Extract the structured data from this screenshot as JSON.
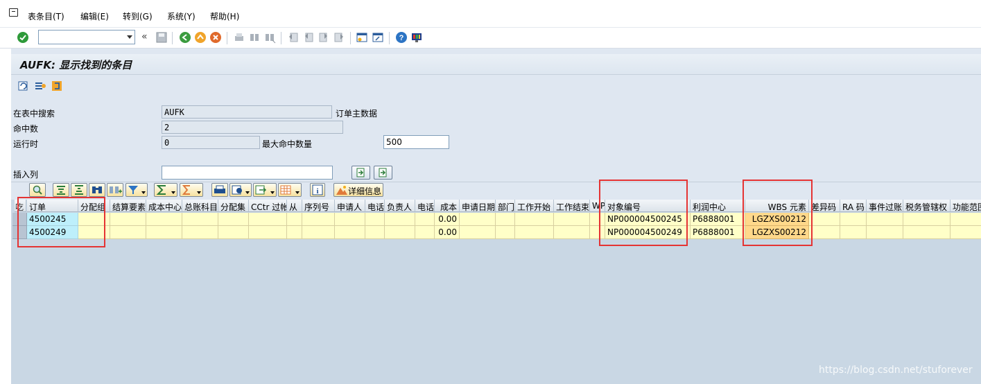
{
  "menu": {
    "items": [
      "表条目(T)",
      "编辑(E)",
      "转到(G)",
      "系统(Y)",
      "帮助(H)"
    ]
  },
  "toolbar": {
    "command_value": "",
    "back_glyph": "«"
  },
  "title": "AUFK: 显示找到的条目",
  "form": {
    "search_in_table_label": "在表中搜索",
    "table_value": "AUFK",
    "table_desc": "订单主数据",
    "hits_label": "命中数",
    "hits_value": "2",
    "runtime_label": "运行时",
    "runtime_value": "0",
    "max_hits_label": "最大命中数量",
    "max_hits_value": "500",
    "insert_col_label": "插入列",
    "insert_col_value": ""
  },
  "grid_toolbar": {
    "detail_label": "详细信息"
  },
  "grid": {
    "columns": [
      "订单",
      "分配组",
      "结算要素",
      "成本中心",
      "总账科目",
      "分配集",
      "CCtr 过帐",
      "从",
      "序列号",
      "申请人",
      "电话",
      "负责人",
      "电话",
      "成本",
      "申请日期",
      "部门",
      "工作开始",
      "工作结束",
      "WP",
      "对象编号",
      "利润中心",
      "WBS 元素",
      "差异码",
      "RA 码",
      "事件过账",
      "税务管辖权",
      "功能范围"
    ],
    "row_header_label": "吃",
    "rows": [
      [
        "4500245",
        "",
        "",
        "",
        "",
        "",
        "",
        "",
        "",
        "",
        "",
        "",
        "",
        "0.00",
        "",
        "",
        "",
        "",
        "",
        "NP000004500245",
        "P6888001",
        "LGZXS00212",
        "",
        "",
        "",
        "",
        ""
      ],
      [
        "4500249",
        "",
        "",
        "",
        "",
        "",
        "",
        "",
        "",
        "",
        "",
        "",
        "",
        "0.00",
        "",
        "",
        "",
        "",
        "",
        "NP000004500249",
        "P6888001",
        "LGZXS00212",
        "",
        "",
        "",
        "",
        ""
      ]
    ]
  },
  "watermark": "https://blog.csdn.net/stuforever",
  "colors": {
    "key_cell": "#bdeffb",
    "data_cell": "#ffffc8",
    "wbs_cell": "#ffd88a",
    "highlight_box": "#e53333",
    "background": "#dfe7f1"
  }
}
